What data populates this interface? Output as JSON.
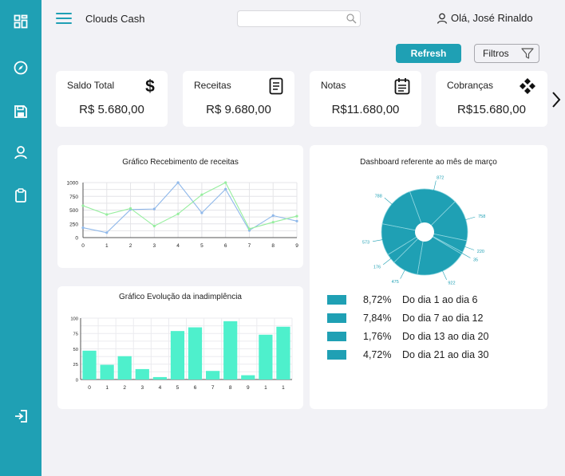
{
  "app": {
    "title": "Clouds Cash"
  },
  "search": {
    "placeholder": "",
    "value": ""
  },
  "user": {
    "greeting": "Olá, José Rinaldo"
  },
  "actions": {
    "refresh_label": "Refresh",
    "filter_label": "Filtros"
  },
  "colors": {
    "accent": "#1fa0b4",
    "line_blue": "#8fb8ea",
    "line_green": "#96ee9e",
    "bar_mint": "#4ef0cc",
    "background": "#f2f2f6"
  },
  "sidebar": {
    "items": [
      {
        "icon": "dashboard-icon"
      },
      {
        "icon": "compass-icon"
      },
      {
        "icon": "save-icon"
      },
      {
        "icon": "user-icon"
      },
      {
        "icon": "clipboard-icon"
      },
      {
        "icon": "logout-icon"
      }
    ]
  },
  "cards": [
    {
      "label": "Saldo Total",
      "value": "R$ 5.680,00",
      "icon": "dollar-icon"
    },
    {
      "label": "Receitas",
      "value": "R$ 9.680,00",
      "icon": "document-icon"
    },
    {
      "label": "Notas",
      "value": "R$11.680,00",
      "icon": "calendar-notes-icon"
    },
    {
      "label": "Cobranças",
      "value": "R$15.680,00",
      "icon": "diamond-arrows-icon"
    }
  ],
  "chart_data": [
    {
      "type": "line",
      "title": "Gráfico Recebimento de receitas",
      "x": [
        0,
        1,
        2,
        3,
        4,
        5,
        6,
        7,
        8,
        9
      ],
      "yticks": [
        0,
        250,
        500,
        750,
        1000
      ],
      "xticks": [
        "0",
        "1",
        "2",
        "3",
        "4",
        "5",
        "6",
        "7",
        "8",
        "9"
      ],
      "ylim": [
        0,
        1000
      ],
      "grid": true,
      "series": [
        {
          "values": [
            180,
            90,
            510,
            520,
            1000,
            450,
            880,
            130,
            400,
            300
          ]
        },
        {
          "values": [
            580,
            420,
            530,
            210,
            430,
            780,
            1000,
            160,
            280,
            390
          ]
        }
      ]
    },
    {
      "type": "bar",
      "title": "Gráfico Evolução da inadimplência",
      "categories": [
        "0",
        "1",
        "2",
        "3",
        "4",
        "5",
        "6",
        "7",
        "8",
        "9",
        "10",
        "11"
      ],
      "tick_labels": [
        "0",
        "1",
        "2",
        "3",
        "4",
        "5",
        "6",
        "7",
        "8",
        "9",
        "1",
        "1"
      ],
      "values": [
        47,
        24,
        38,
        17,
        4,
        79,
        85,
        14,
        95,
        7,
        73,
        86
      ],
      "yticks": [
        "0",
        "25",
        "50",
        "75",
        "100"
      ],
      "ylim": [
        0,
        100
      ],
      "grid": true
    },
    {
      "type": "pie",
      "title": "Dashboard referente ao mês de março",
      "slices": [
        {
          "value": 872,
          "label": "872"
        },
        {
          "value": 758,
          "label": "758"
        },
        {
          "value": 220,
          "label": "220"
        },
        {
          "value": 35,
          "label": "35"
        },
        {
          "value": 922,
          "label": "922"
        },
        {
          "value": 475,
          "label": "475"
        },
        {
          "value": 176,
          "label": "176"
        },
        {
          "value": 573,
          "label": "573"
        },
        {
          "value": 788,
          "label": "788"
        }
      ],
      "legend": [
        {
          "percent": "8,72%",
          "label": "Do dia 1 ao dia 6"
        },
        {
          "percent": "7,84%",
          "label": "Do dia 7 ao dia 12"
        },
        {
          "percent": "1,76%",
          "label": "Do dia 13 ao dia 20"
        },
        {
          "percent": "4,72%",
          "label": "Do dia 21 ao dia 30"
        }
      ]
    }
  ]
}
